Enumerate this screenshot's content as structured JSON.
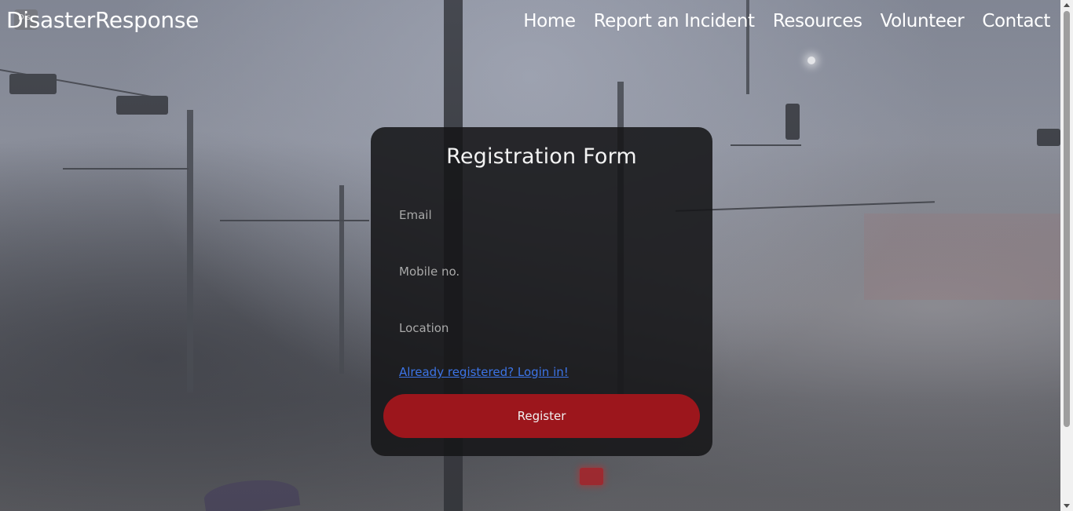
{
  "brand": {
    "name": "DisasterResponse",
    "logo_text": "Dis"
  },
  "nav": {
    "items": [
      {
        "label": "Home"
      },
      {
        "label": "Report an Incident"
      },
      {
        "label": "Resources"
      },
      {
        "label": "Volunteer"
      },
      {
        "label": "Contact"
      }
    ]
  },
  "form": {
    "title": "Registration Form",
    "email": {
      "placeholder": "Email",
      "value": ""
    },
    "mobile": {
      "placeholder": "Mobile no.",
      "value": ""
    },
    "location": {
      "placeholder": "Location",
      "value": ""
    },
    "login_link": "Already registered? Login in!",
    "submit_label": "Register"
  },
  "colors": {
    "card_background": "#161618",
    "button": "#9c161c",
    "link": "#3c74e6",
    "text": "#ffffff"
  }
}
